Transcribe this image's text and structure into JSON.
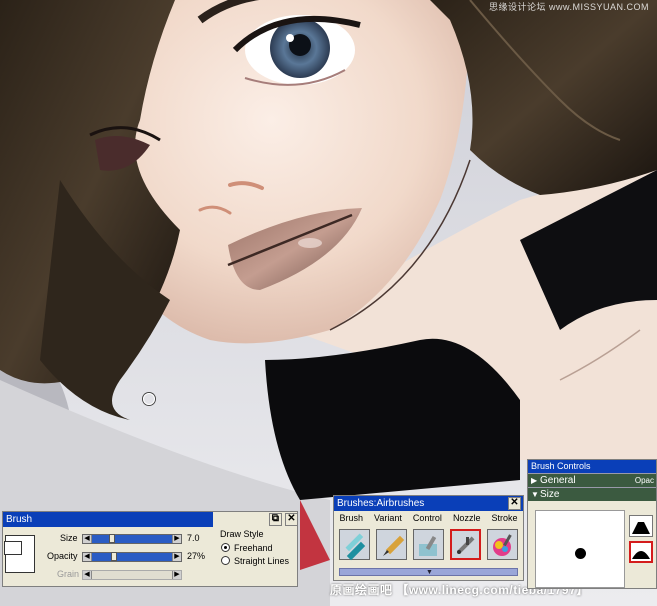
{
  "watermarks": {
    "top": "思缘设计论坛 www.MISSYUAN.COM",
    "bottom": "原画绘画吧 【www.linecg.com/tieba/1797】"
  },
  "brush_bar": {
    "title": "Brush",
    "size_label": "Size",
    "size_value": "7.0",
    "size_fraction": 0.08,
    "opacity_label": "Opacity",
    "opacity_value": "27%",
    "opacity_fraction": 0.27,
    "grain_label": "Grain",
    "draw_style_label": "Draw Style",
    "freehand_label": "Freehand",
    "straight_label": "Straight Lines",
    "selected_style": "Freehand",
    "dock_icon": "dock-icon",
    "close_icon": "close-icon"
  },
  "brushes_palette": {
    "title": "Brushes:Airbrushes",
    "tabs": [
      "Brush",
      "Variant",
      "Control",
      "Nozzle",
      "Stroke"
    ],
    "tools": [
      "airbrush-variant-1",
      "airbrush-variant-2",
      "airbrush-variant-3",
      "airbrush-variant-4",
      "airbrush-variant-5"
    ],
    "selected_tool_index": 3
  },
  "brush_controls": {
    "title": "Brush Controls",
    "general_label": "General",
    "general_extra": "Opac",
    "size_label": "Size"
  },
  "colors": {
    "title_bar": "#0a3fb8",
    "palette_bg": "#ece9d8",
    "selection_red": "#d41c1c",
    "slider_fill": "#2a5cc4",
    "section_green": "#3b5a40"
  }
}
